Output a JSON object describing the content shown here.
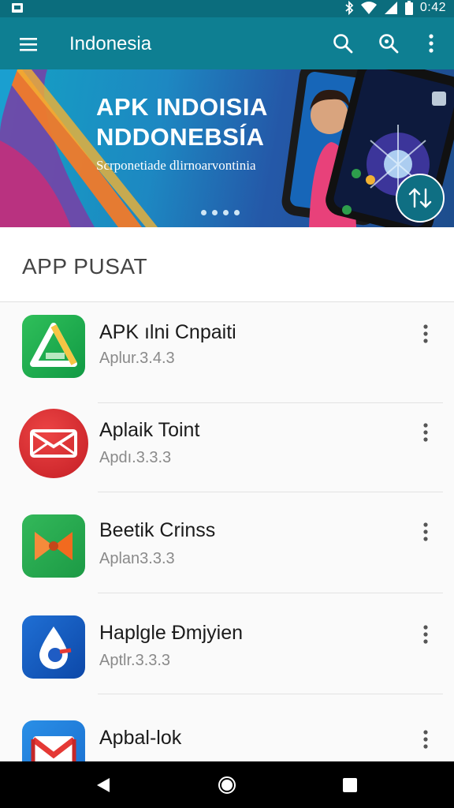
{
  "status_bar": {
    "time": "0:42",
    "icons": [
      "sim-icon",
      "bluetooth-icon",
      "wifi-icon",
      "signal-icon",
      "battery-icon"
    ]
  },
  "app_bar": {
    "title": "Indonesia",
    "icons": [
      "menu-icon",
      "search-icon",
      "search-zoom-icon",
      "more-vert-icon"
    ]
  },
  "banner": {
    "title_line1": "APK INDOISIA",
    "title_line2": "NDDONEBSÍA",
    "subtitle": "Scrponetiade dlirnoarvontinia",
    "page_dots": 4,
    "action_icon": "share-arrows-icon"
  },
  "section": {
    "title": "APP PUSAT"
  },
  "apps": [
    {
      "name": "APK ılni Cnpaiti",
      "version": "Aplur.3.4.3",
      "icon": "triangle-drive-icon"
    },
    {
      "name": "Aplaik Toint",
      "version": "Apdı.3.3.3",
      "icon": "envelope-mail-icon"
    },
    {
      "name": "Beetik Crinss",
      "version": "Aplan3.3.3",
      "icon": "bowtie-icon"
    },
    {
      "name": "Haplgle Đmjyien",
      "version": "Aptlr.3.3.3",
      "icon": "water-drop-icon"
    },
    {
      "name": "Apbal-lok",
      "version": "",
      "icon": "gmail-icon"
    }
  ],
  "nav_bar": {
    "icons": [
      "back-icon",
      "home-icon",
      "recents-icon"
    ]
  },
  "colors": {
    "status_bar": "#0b6d7d",
    "app_bar": "#0e7f92",
    "list_background": "#fafafa",
    "nav_bar": "#000000"
  }
}
